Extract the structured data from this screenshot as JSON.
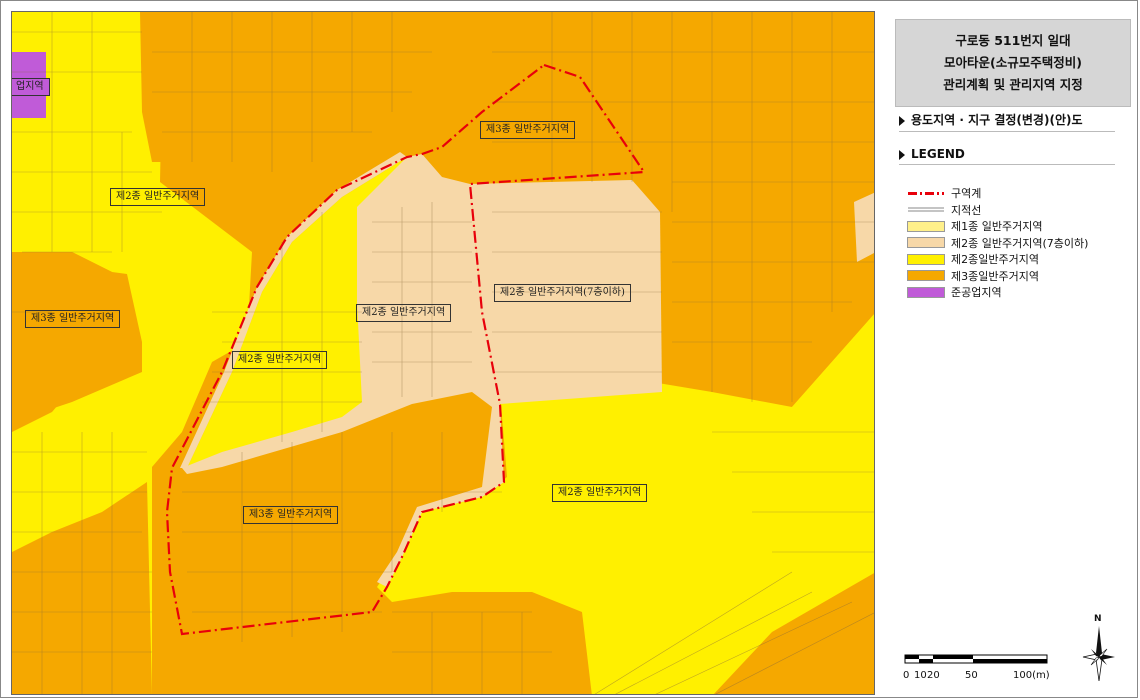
{
  "title": {
    "line1": "구로동 511번지 일대",
    "line2": "모아타운(소규모주택정비)",
    "line3": "관리계획 및 관리지역 지정"
  },
  "section_map": "용도지역 · 지구 결정(변경)(안)도",
  "section_legend": "LEGEND",
  "legend": [
    {
      "label": "구역계",
      "color": "#E8000B",
      "kind": "boundary"
    },
    {
      "label": "지적선",
      "color": "#888888",
      "kind": "line"
    },
    {
      "label": "제1종 일반주거지역",
      "color": "#FFF08A",
      "kind": "fill"
    },
    {
      "label": "제2종 일반주거지역(7층이하)",
      "color": "#F7D8A8",
      "kind": "fill"
    },
    {
      "label": "제2종일반주거지역",
      "color": "#FFF000",
      "kind": "fill"
    },
    {
      "label": "제3종일반주거지역",
      "color": "#F5A800",
      "kind": "fill"
    },
    {
      "label": "준공업지역",
      "color": "#C05BD8",
      "kind": "fill"
    }
  ],
  "zone_labels": {
    "l1": "업지역",
    "l2": "제2종 일반주거지역",
    "l3": "제3종 일반주거지역",
    "l4": "제3종 일반주거지역",
    "l5": "제2종 일반주거지역(7층이하)",
    "l6": "제2종 일반주거지역",
    "l7": "제2종 일반주거지역",
    "l8": "제2종 일반주거지역",
    "l9": "제3종 일반주거지역"
  },
  "scale": {
    "t0": "0",
    "t1": "10",
    "t2": "20",
    "t3": "50",
    "t4": "100(m)"
  },
  "north_label": "N",
  "colors": {
    "res1": "#FFF08A",
    "res2_7": "#F7D8A8",
    "res2": "#FFF000",
    "res3": "#F5A800",
    "industrial": "#C05BD8",
    "boundary": "#E8000B"
  }
}
